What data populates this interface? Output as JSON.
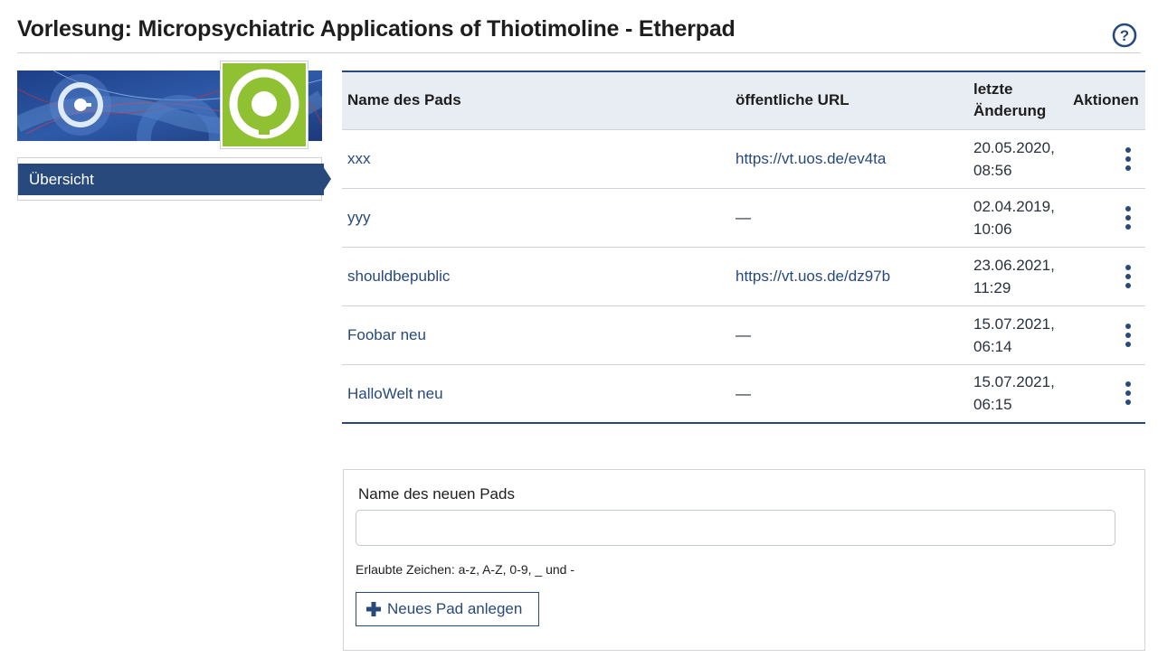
{
  "header": {
    "title": "Vorlesung: Micropsychiatric Applications of Thiotimoline - Etherpad",
    "help_icon": "help-circle-icon"
  },
  "sidebar": {
    "logo_icon": "etherpad-logo-icon",
    "nav_items": [
      {
        "label": "Übersicht",
        "active": true
      }
    ]
  },
  "table": {
    "columns": [
      "Name des Pads",
      "öffentliche URL",
      "letzte Änderung",
      "Aktionen"
    ],
    "rows": [
      {
        "name": "xxx",
        "url": "https://vt.uos.de/ev4ta",
        "date": "20.05.2020,",
        "time": "08:56"
      },
      {
        "name": "yyy",
        "url": "—",
        "date": "02.04.2019,",
        "time": "10:06"
      },
      {
        "name": "shouldbepublic",
        "url": "https://vt.uos.de/dz97b",
        "date": "23.06.2021,",
        "time": "11:29"
      },
      {
        "name": "Foobar neu",
        "url": "—",
        "date": "15.07.2021,",
        "time": "06:14"
      },
      {
        "name": "HalloWelt neu",
        "url": "—",
        "date": "15.07.2021,",
        "time": "06:15"
      }
    ],
    "action_icon": "more-vertical-icon"
  },
  "new_pad": {
    "label": "Name des neuen Pads",
    "input_value": "",
    "hint": "Erlaubte Zeichen: a-z, A-Z, 0-9, _ und -",
    "button_label": "Neues Pad anlegen",
    "button_icon": "plus-icon"
  },
  "colors": {
    "primary": "#28497c",
    "logo_green": "#8fc132",
    "header_bg": "#e8ecf3"
  }
}
